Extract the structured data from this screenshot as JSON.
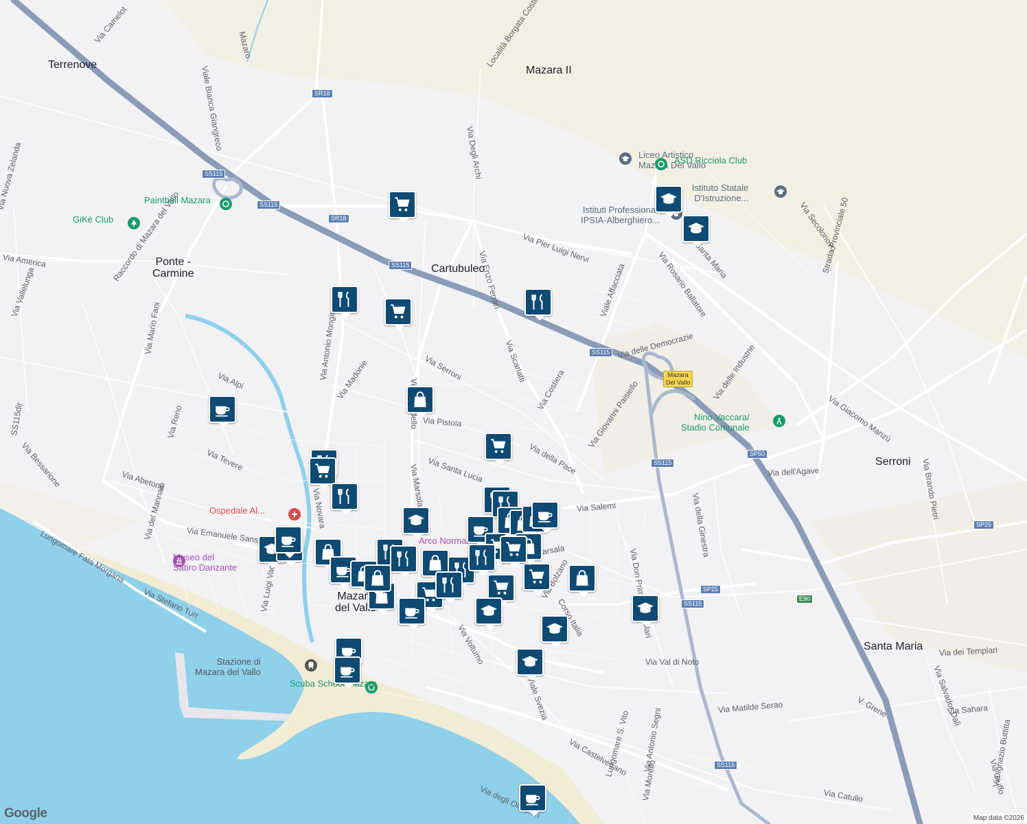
{
  "places": [
    {
      "name": "Terrenove"
    },
    {
      "name": "Mazara II"
    },
    {
      "name": "Cartubuleo"
    },
    {
      "name": "Ponte -\nCarmine"
    },
    {
      "name": "Serroni"
    },
    {
      "name": "Santa Maria"
    },
    {
      "name": "Mazara\ndel Vallo"
    }
  ],
  "streets": [
    "Via Camelot",
    "Viale Bianca Giangreco",
    "Mazaro",
    "Località Borgata Costiera",
    "Via Degli Archi",
    "Via Nuova Zelanda",
    "Raccordo di Mazara del Vallo",
    "Via America",
    "Via Vallelunga",
    "Via Mario Fani",
    "Via Alpi",
    "Via Reno",
    "SS115dir",
    "Via Bessarione",
    "Via Tevere",
    "Via Abetone",
    "Via del Mannaio",
    "Lungomare Fata Morgana",
    "Via Emanuele Sansone",
    "Via Stefano Turr",
    "Via Luigi Vaccara",
    "Via Antonio Mongitore",
    "Via Madonie",
    "Via Serroni",
    "Via Pistoia",
    "Via Marsala",
    "Via Santa Lucia",
    "Via Enzo Ferrari",
    "Via Scarlatti",
    "Via Costiera",
    "Via Pier Luigi Nervi",
    "Viale Affacciata",
    "Via Rosario Ballatore",
    "Via delle Democrazie",
    "Via Giovanni Paisiello",
    "Via della Pace",
    "Via Salemi",
    "Via delle Industrie",
    "Via Giacomo Manzù",
    "Via Secolonovo",
    "Strada Provinciale 50",
    "Via dell'Agave",
    "Via della Ginestra",
    "Via Don Primo Mazzolari",
    "Corso Italia",
    "Via Bolzano",
    "Via Voltumo",
    "Via Val di Noto",
    "Via Castelvetrano",
    "Viale Svezia",
    "Via Antonio Segni",
    "Via Matilde Serao",
    "Via dei Templari",
    "Via Salvador Dalì",
    "V. Grene",
    "Via Sahara",
    "Via Giuffo",
    "Via Ignazio Buttitta",
    "Via Catullo",
    "Via Morello",
    "Lungomare S. Vito",
    "Via degli Oleandri",
    "Via Brando Pietri",
    "Santa Maria",
    "Via Novara",
    "Via Marsala",
    "Via Pirandello"
  ],
  "shields": [
    "SS115",
    "SS115",
    "SS115",
    "SS115",
    "SS115",
    "SS115",
    "SS115",
    "SR18",
    "SR18",
    "SP50",
    "SP25",
    "SP25",
    "E90"
  ],
  "exit_label": "Mazara\nDel Vallo",
  "pois": [
    {
      "name": "Paintball Mazara",
      "icon": "sport-icon",
      "color": "#1a9a6b"
    },
    {
      "name": "GiKè Club",
      "icon": "park-icon",
      "color": "#1a9a6b"
    },
    {
      "name": "Liceo Artistico\nMazara Del Vallo",
      "icon": "school-icon",
      "color": "#5a6d82"
    },
    {
      "name": "ASD Ricciola Club",
      "icon": "sport-icon",
      "color": "#1a9a6b"
    },
    {
      "name": "Istituto Statale\nD'Istruzione...",
      "icon": "school-icon",
      "color": "#5a6d82"
    },
    {
      "name": "Istituti Professionali\nIPSIA-Alberghiero...",
      "icon": "school-icon",
      "color": "#5a6d82"
    },
    {
      "name": "Nino Vaccara/\nStadio Comunale",
      "icon": "stadium-icon",
      "color": "#1a9a6b"
    },
    {
      "name": "Ospedale Al...",
      "icon": "hospital-icon",
      "color": "#d94a4a"
    },
    {
      "name": "Museo del\nSatiro Danzante",
      "icon": "museum-icon",
      "color": "#a34fb5"
    },
    {
      "name": "Arco Normanno",
      "icon": "landmark-icon",
      "color": "#a34fb5"
    },
    {
      "name": "Stazione di\nMazara del Vallo",
      "icon": "train-icon",
      "color": "#555555"
    },
    {
      "name": "Scuba School Mazara",
      "icon": "sport-icon",
      "color": "#1a9a6b"
    }
  ],
  "markers": [
    "cart",
    "restaurant",
    "cart",
    "restaurant",
    "bag",
    "cart",
    "coffee",
    "restaurant",
    "cart",
    "restaurant",
    "school",
    "school",
    "school",
    "coffee",
    "school",
    "bag",
    "coffee",
    "cart",
    "restaurant",
    "restaurant",
    "bag",
    "bag",
    "bag",
    "coffee",
    "cart",
    "restaurant",
    "bag",
    "restaurant",
    "cart",
    "restaurant",
    "cart",
    "cart",
    "bag",
    "coffee",
    "coffee",
    "coffee",
    "coffee",
    "school",
    "school",
    "school",
    "school",
    "school",
    "coffee",
    "bag",
    "restaurant",
    "restaurant",
    "bag",
    "bag",
    "bag",
    "cart"
  ],
  "attribution": "Map data ©2026",
  "logo": "Google"
}
